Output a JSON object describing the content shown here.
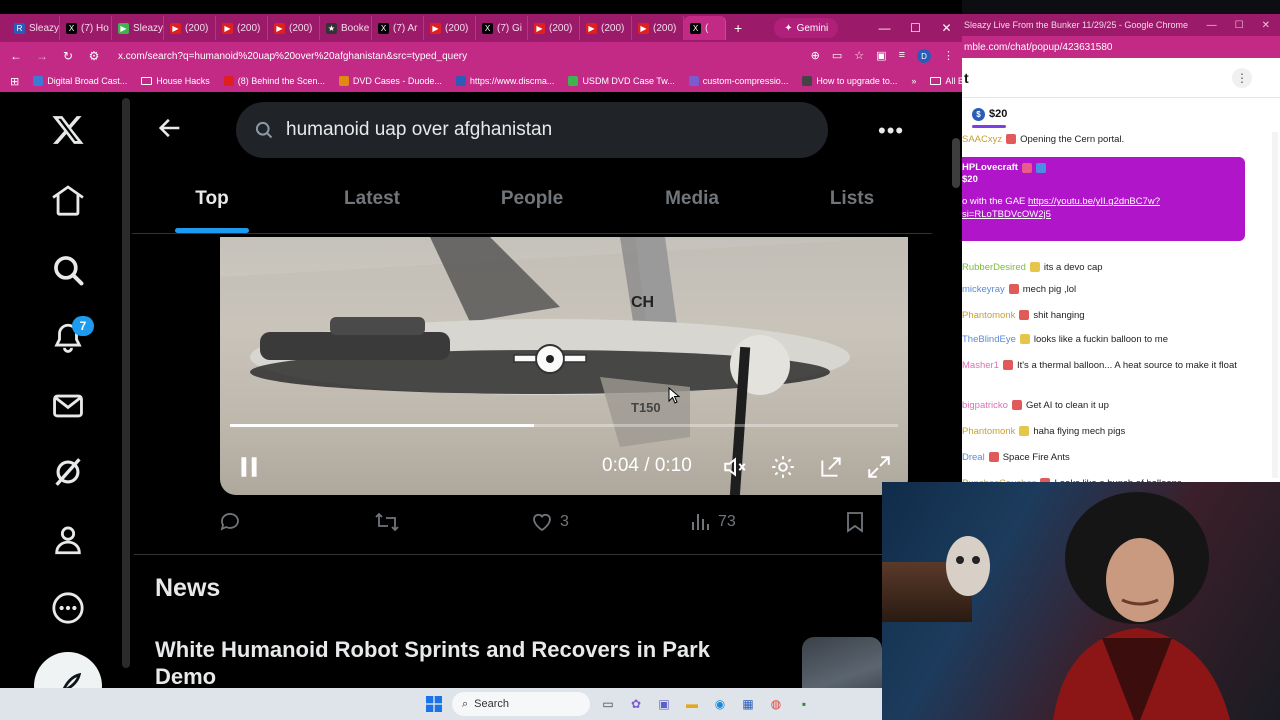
{
  "browser": {
    "tabs": [
      {
        "label": "Sleazy",
        "fav": "R",
        "color": "#2b5cb8"
      },
      {
        "label": "(7) Ho",
        "fav": "X",
        "color": "#000000"
      },
      {
        "label": "Sleazy",
        "fav": "▶",
        "color": "#3fb34f"
      },
      {
        "label": "(200)",
        "fav": "▶",
        "color": "#e02020"
      },
      {
        "label": "(200)",
        "fav": "▶",
        "color": "#e02020"
      },
      {
        "label": "(200)",
        "fav": "▶",
        "color": "#e02020"
      },
      {
        "label": "Booke",
        "fav": "★",
        "color": "#333333"
      },
      {
        "label": "(7) Ar",
        "fav": "X",
        "color": "#000000"
      },
      {
        "label": "(200)",
        "fav": "▶",
        "color": "#e02020"
      },
      {
        "label": "(7) Gi",
        "fav": "X",
        "color": "#000000"
      },
      {
        "label": "(200)",
        "fav": "▶",
        "color": "#e02020"
      },
      {
        "label": "(200)",
        "fav": "▶",
        "color": "#e02020"
      },
      {
        "label": "(200)",
        "fav": "▶",
        "color": "#e02020"
      },
      {
        "label": "(",
        "fav": "X",
        "color": "#000000"
      }
    ],
    "gemini_label": "Gemini",
    "url": "x.com/search?q=humanoid%20uap%20over%20afghanistan&src=typed_query",
    "profile_initial": "D",
    "bookmarks": [
      {
        "label": "Digital Broad Cast...",
        "color": "#3a7bd5"
      },
      {
        "label": "House Hacks",
        "folder": true
      },
      {
        "label": "(8) Behind the Scen...",
        "color": "#e02020"
      },
      {
        "label": "DVD Cases - Duode...",
        "color": "#e08a10"
      },
      {
        "label": "https://www.discma...",
        "color": "#2b5cb8"
      },
      {
        "label": "USDM DVD Case Tw...",
        "color": "#3fb34f"
      },
      {
        "label": "custom-compressio...",
        "color": "#7a5cd0"
      },
      {
        "label": "How to upgrade to...",
        "color": "#444444"
      }
    ],
    "all_bookmarks_label": "All Bookmarks"
  },
  "x": {
    "notification_count": "7",
    "search_query": "humanoid uap over afghanistan",
    "tabs": [
      "Top",
      "Latest",
      "People",
      "Media",
      "Lists"
    ],
    "active_tab": "Top",
    "video": {
      "time": "0:04 / 0:10",
      "progress": 0.4545,
      "tail_text": "CH",
      "tail_number": "T150"
    },
    "actions": {
      "likes": "3",
      "views": "73"
    },
    "news_heading": "News",
    "news_title": "White Humanoid Robot Sprints and Recovers in Park Demo"
  },
  "taskbar": {
    "search_label": "Search"
  },
  "chat": {
    "window_title": "Sleazy Live From the Bunker 11/29/25 - Google Chrome",
    "url": "mble.com/chat/popup/423631580",
    "header": "t",
    "tip_amount": "$20",
    "messages": [
      {
        "user": "SAACxyz",
        "text": "Opening the Cern portal.",
        "color": "#c8a030"
      },
      {
        "user": "RubberDesired",
        "text": "its a devo cap",
        "color": "#7dbb3a"
      },
      {
        "user": "mickeyray",
        "text": "mech pig ,lol",
        "color": "#5a8ad8"
      },
      {
        "user": "Phantomonk",
        "text": "shit hanging",
        "color": "#c8a030"
      },
      {
        "user": "TheBlindEye",
        "text": "looks like a fuckin balloon to me",
        "color": "#5a8ad8"
      },
      {
        "user": "Masher1",
        "text": "It's a thermal balloon... A heat source to make it float",
        "color": "#e070b0"
      },
      {
        "user": "bigpatricko",
        "text": "Get AI to clean it up",
        "color": "#e070b0"
      },
      {
        "user": "Phantomonk",
        "text": "haha flying mech pigs",
        "color": "#c8a030"
      },
      {
        "user": "Dreal",
        "text": "Space Fire Ants",
        "color": "#5a8ad8"
      },
      {
        "user": "PunchesCouches",
        "text": "Looks like a bunch of balloons",
        "color": "#c8a030"
      }
    ],
    "superchat": {
      "user": "HPLovecraft",
      "amount": "$20",
      "text_prefix": "o with the GAE ",
      "link": "https://youtu.be/yII.g2dnBC7w?si=RLoTBDVcOW2j5"
    }
  }
}
